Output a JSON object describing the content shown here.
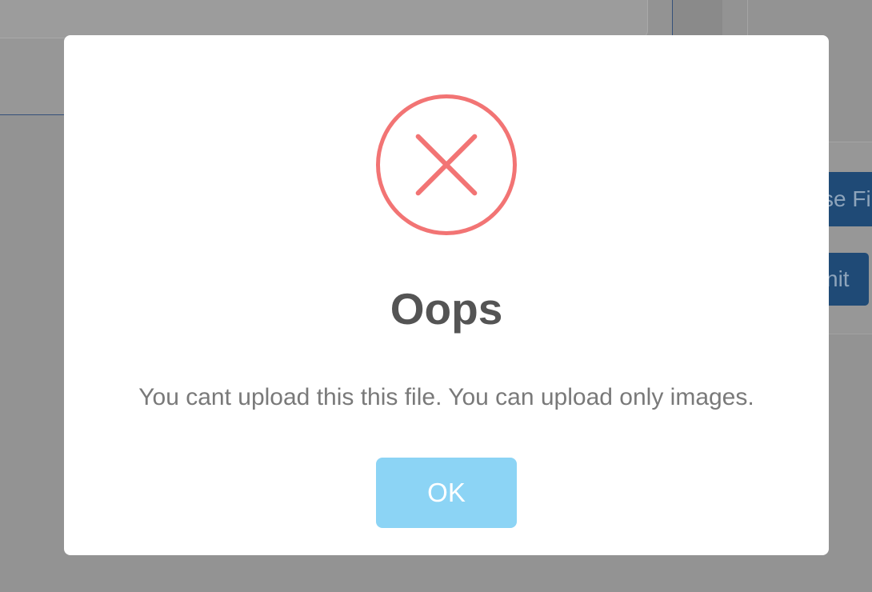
{
  "background": {
    "choose_file_label": "se Fi",
    "submit_label": "nit"
  },
  "dialog": {
    "icon": "error-x-icon",
    "title": "Oops",
    "message": "You cant upload this this file. You can upload only images.",
    "ok_label": "OK"
  },
  "colors": {
    "error_red": "#f27474",
    "ok_button": "#8cd4f5",
    "title_text": "#545454",
    "message_text": "#797979",
    "dim_backdrop": "#939393",
    "app_button": "#1f4a76"
  }
}
